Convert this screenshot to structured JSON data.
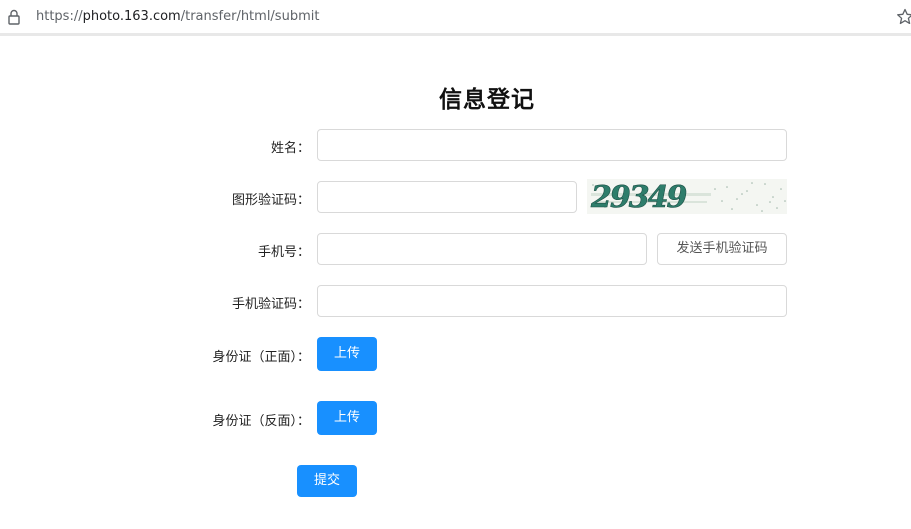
{
  "browser": {
    "url_prefix": "https://",
    "url_host": "photo.163.com",
    "url_path": "/transfer/html/submit"
  },
  "form": {
    "title": "信息登记",
    "name_label": "姓名：",
    "name_value": "",
    "captcha_label": "图形验证码：",
    "captcha_value": "",
    "captcha_text": "29349",
    "phone_label": "手机号：",
    "phone_value": "",
    "send_code_label": "发送手机验证码",
    "sms_code_label": "手机验证码：",
    "sms_code_value": "",
    "id_front_label": "身份证（正面）：",
    "id_front_upload_label": "上传",
    "id_back_label": "身份证（反面）：",
    "id_back_upload_label": "上传",
    "submit_label": "提交"
  },
  "colors": {
    "primary": "#1890ff",
    "border": "#d9d9d9"
  }
}
